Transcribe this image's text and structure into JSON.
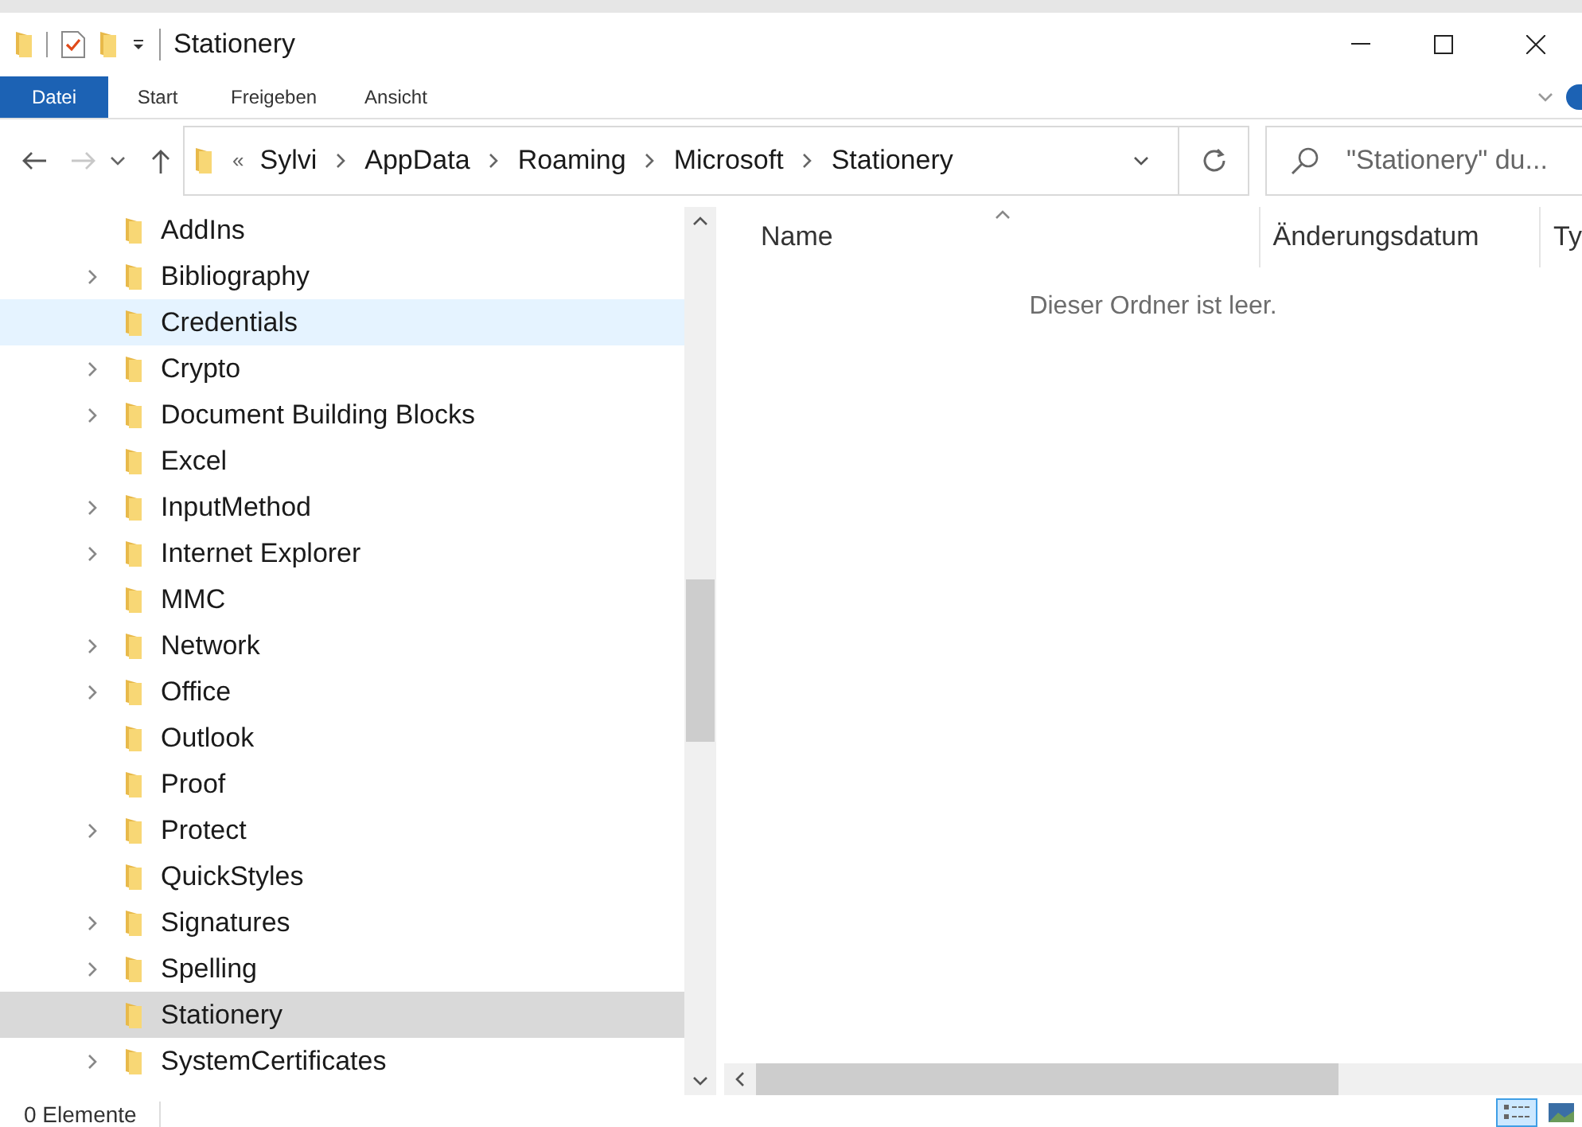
{
  "window": {
    "title": "Stationery"
  },
  "ribbon_tabs": [
    {
      "label": "Datei",
      "kind": "file"
    },
    {
      "label": "Start",
      "kind": "tab"
    },
    {
      "label": "Freigeben",
      "kind": "tab"
    },
    {
      "label": "Ansicht",
      "kind": "tab"
    }
  ],
  "breadcrumb": {
    "overflow": "«",
    "segments": [
      "Sylvi",
      "AppData",
      "Roaming",
      "Microsoft",
      "Stationery"
    ]
  },
  "search": {
    "placeholder": "\"Stationery\" du..."
  },
  "tree": [
    {
      "label": "AddIns",
      "expandable": false,
      "selected": false,
      "hovered": false
    },
    {
      "label": "Bibliography",
      "expandable": true,
      "selected": false,
      "hovered": false
    },
    {
      "label": "Credentials",
      "expandable": false,
      "selected": false,
      "hovered": true
    },
    {
      "label": "Crypto",
      "expandable": true,
      "selected": false,
      "hovered": false
    },
    {
      "label": "Document Building Blocks",
      "expandable": true,
      "selected": false,
      "hovered": false
    },
    {
      "label": "Excel",
      "expandable": false,
      "selected": false,
      "hovered": false
    },
    {
      "label": "InputMethod",
      "expandable": true,
      "selected": false,
      "hovered": false
    },
    {
      "label": "Internet Explorer",
      "expandable": true,
      "selected": false,
      "hovered": false
    },
    {
      "label": "MMC",
      "expandable": false,
      "selected": false,
      "hovered": false
    },
    {
      "label": "Network",
      "expandable": true,
      "selected": false,
      "hovered": false
    },
    {
      "label": "Office",
      "expandable": true,
      "selected": false,
      "hovered": false
    },
    {
      "label": "Outlook",
      "expandable": false,
      "selected": false,
      "hovered": false
    },
    {
      "label": "Proof",
      "expandable": false,
      "selected": false,
      "hovered": false
    },
    {
      "label": "Protect",
      "expandable": true,
      "selected": false,
      "hovered": false
    },
    {
      "label": "QuickStyles",
      "expandable": false,
      "selected": false,
      "hovered": false
    },
    {
      "label": "Signatures",
      "expandable": true,
      "selected": false,
      "hovered": false
    },
    {
      "label": "Spelling",
      "expandable": true,
      "selected": false,
      "hovered": false
    },
    {
      "label": "Stationery",
      "expandable": false,
      "selected": true,
      "hovered": false
    },
    {
      "label": "SystemCertificates",
      "expandable": true,
      "selected": false,
      "hovered": false
    }
  ],
  "columns": [
    {
      "label": "Name",
      "sorted": true
    },
    {
      "label": "Änderungsdatum",
      "sorted": false
    },
    {
      "label": "Ty",
      "sorted": false
    }
  ],
  "empty_message": "Dieser Ordner ist leer.",
  "status_bar": {
    "count": "0 Elemente"
  },
  "view_buttons": [
    {
      "kind": "details",
      "selected": true
    },
    {
      "kind": "tiles",
      "selected": false
    }
  ]
}
